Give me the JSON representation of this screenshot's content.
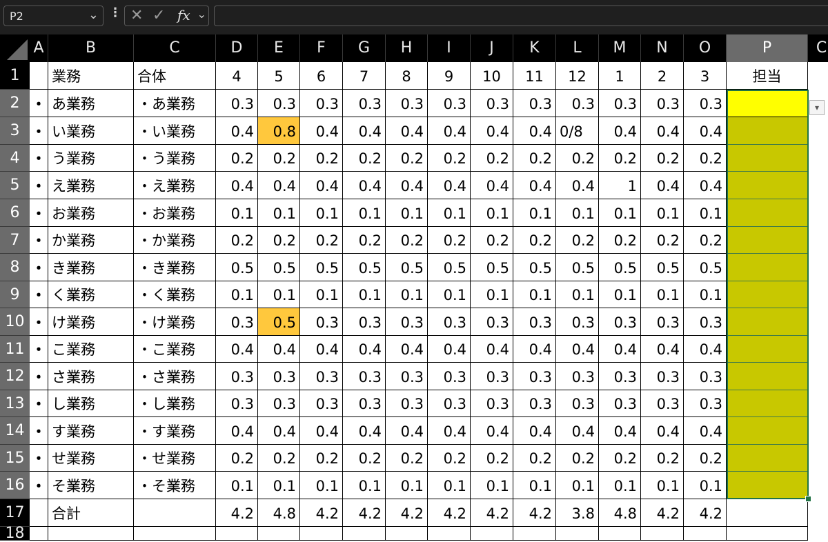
{
  "namebox": {
    "value": "P2"
  },
  "formula_bar": {
    "formula": ""
  },
  "columns": [
    "A",
    "B",
    "C",
    "D",
    "E",
    "F",
    "G",
    "H",
    "I",
    "J",
    "K",
    "L",
    "M",
    "N",
    "O",
    "P",
    "Q"
  ],
  "visible_col_labels": [
    "A",
    "B",
    "C",
    "D",
    "E",
    "F",
    "G",
    "H",
    "I",
    "J",
    "K",
    "L",
    "M",
    "N",
    "O",
    "P",
    "C"
  ],
  "rows": [
    [
      "",
      "業務",
      "合体",
      "4",
      "5",
      "6",
      "7",
      "8",
      "9",
      "10",
      "11",
      "12",
      "1",
      "2",
      "3",
      "担当"
    ],
    [
      "・",
      "あ業務",
      "・あ業務",
      "0.3",
      "0.3",
      "0.3",
      "0.3",
      "0.3",
      "0.3",
      "0.3",
      "0.3",
      "0.3",
      "0.3",
      "0.3",
      "0.3",
      ""
    ],
    [
      "・",
      "い業務",
      "・い業務",
      "0.4",
      "0.8",
      "0.4",
      "0.4",
      "0.4",
      "0.4",
      "0.4",
      "0.4",
      "0/8",
      "0.4",
      "0.4",
      "0.4",
      ""
    ],
    [
      "・",
      "う業務",
      "・う業務",
      "0.2",
      "0.2",
      "0.2",
      "0.2",
      "0.2",
      "0.2",
      "0.2",
      "0.2",
      "0.2",
      "0.2",
      "0.2",
      "0.2",
      ""
    ],
    [
      "・",
      "え業務",
      "・え業務",
      "0.4",
      "0.4",
      "0.4",
      "0.4",
      "0.4",
      "0.4",
      "0.4",
      "0.4",
      "0.4",
      "1",
      "0.4",
      "0.4",
      ""
    ],
    [
      "・",
      "お業務",
      "・お業務",
      "0.1",
      "0.1",
      "0.1",
      "0.1",
      "0.1",
      "0.1",
      "0.1",
      "0.1",
      "0.1",
      "0.1",
      "0.1",
      "0.1",
      ""
    ],
    [
      "・",
      "か業務",
      "・か業務",
      "0.2",
      "0.2",
      "0.2",
      "0.2",
      "0.2",
      "0.2",
      "0.2",
      "0.2",
      "0.2",
      "0.2",
      "0.2",
      "0.2",
      ""
    ],
    [
      "・",
      "き業務",
      "・き業務",
      "0.5",
      "0.5",
      "0.5",
      "0.5",
      "0.5",
      "0.5",
      "0.5",
      "0.5",
      "0.5",
      "0.5",
      "0.5",
      "0.5",
      ""
    ],
    [
      "・",
      "く業務",
      "・く業務",
      "0.1",
      "0.1",
      "0.1",
      "0.1",
      "0.1",
      "0.1",
      "0.1",
      "0.1",
      "0.1",
      "0.1",
      "0.1",
      "0.1",
      ""
    ],
    [
      "・",
      "け業務",
      "・け業務",
      "0.3",
      "0.5",
      "0.3",
      "0.3",
      "0.3",
      "0.3",
      "0.3",
      "0.3",
      "0.3",
      "0.3",
      "0.3",
      "0.3",
      ""
    ],
    [
      "・",
      "こ業務",
      "・こ業務",
      "0.4",
      "0.4",
      "0.4",
      "0.4",
      "0.4",
      "0.4",
      "0.4",
      "0.4",
      "0.4",
      "0.4",
      "0.4",
      "0.4",
      ""
    ],
    [
      "・",
      "さ業務",
      "・さ業務",
      "0.3",
      "0.3",
      "0.3",
      "0.3",
      "0.3",
      "0.3",
      "0.3",
      "0.3",
      "0.3",
      "0.3",
      "0.3",
      "0.3",
      ""
    ],
    [
      "・",
      "し業務",
      "・し業務",
      "0.3",
      "0.3",
      "0.3",
      "0.3",
      "0.3",
      "0.3",
      "0.3",
      "0.3",
      "0.3",
      "0.3",
      "0.3",
      "0.3",
      ""
    ],
    [
      "・",
      "す業務",
      "・す業務",
      "0.4",
      "0.4",
      "0.4",
      "0.4",
      "0.4",
      "0.4",
      "0.4",
      "0.4",
      "0.4",
      "0.4",
      "0.4",
      "0.4",
      ""
    ],
    [
      "・",
      "せ業務",
      "・せ業務",
      "0.2",
      "0.2",
      "0.2",
      "0.2",
      "0.2",
      "0.2",
      "0.2",
      "0.2",
      "0.2",
      "0.2",
      "0.2",
      "0.2",
      ""
    ],
    [
      "・",
      "そ業務",
      "・そ業務",
      "0.1",
      "0.1",
      "0.1",
      "0.1",
      "0.1",
      "0.1",
      "0.1",
      "0.1",
      "0.1",
      "0.1",
      "0.1",
      "0.1",
      ""
    ],
    [
      "",
      "合計",
      "",
      "4.2",
      "4.8",
      "4.2",
      "4.2",
      "4.2",
      "4.2",
      "4.2",
      "4.2",
      "3.8",
      "4.8",
      "4.2",
      "4.2",
      ""
    ]
  ],
  "row_numbers": [
    "1",
    "2",
    "3",
    "4",
    "5",
    "6",
    "7",
    "8",
    "9",
    "10",
    "11",
    "12",
    "13",
    "14",
    "15",
    "16",
    "17",
    "18"
  ],
  "selected": {
    "column": "P",
    "row": "2"
  },
  "colors": {
    "highlight_orange": "#ffc83d",
    "selected_cell_yellow": "#ffff00",
    "filled_olive": "#c8c800",
    "selection_green": "#217346",
    "header_dark": "#000000"
  },
  "icons": {
    "cancel": "cancel-icon",
    "enter": "enter-icon",
    "function": "fx-icon",
    "dropdown": "dropdown-arrow-icon"
  }
}
